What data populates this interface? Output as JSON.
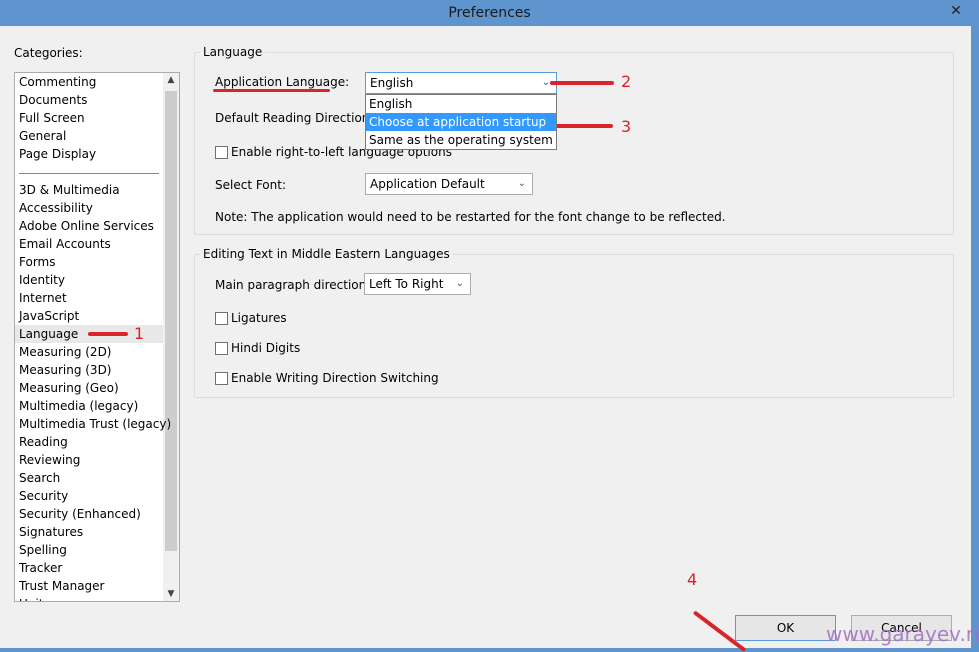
{
  "window": {
    "title": "Preferences",
    "close_icon": "close-icon"
  },
  "categories": {
    "label": "Categories:",
    "top_items": [
      "Commenting",
      "Documents",
      "Full Screen",
      "General",
      "Page Display"
    ],
    "items": [
      "3D & Multimedia",
      "Accessibility",
      "Adobe Online Services",
      "Email Accounts",
      "Forms",
      "Identity",
      "Internet",
      "JavaScript",
      "Language",
      "Measuring (2D)",
      "Measuring (3D)",
      "Measuring (Geo)",
      "Multimedia (legacy)",
      "Multimedia Trust (legacy)",
      "Reading",
      "Reviewing",
      "Search",
      "Security",
      "Security (Enhanced)",
      "Signatures",
      "Spelling",
      "Tracker",
      "Trust Manager",
      "Units"
    ],
    "selected": "Language"
  },
  "language": {
    "title": "Language",
    "app_lang_label": "Application Language:",
    "app_lang_value": "English",
    "dropdown_options": [
      "English",
      "Choose at application startup",
      "Same as the operating system"
    ],
    "highlighted_option": "Choose at application startup",
    "reading_dir_label": "Default Reading Direction:",
    "rtl_label": "Enable right-to-left language options",
    "font_label": "Select Font:",
    "font_value": "Application Default",
    "note": "Note: The application would need to be restarted for the font change to be reflected."
  },
  "middle_east": {
    "title": "Editing Text in Middle Eastern Languages",
    "para_dir_label": "Main paragraph direction:",
    "para_dir_value": "Left To Right",
    "ligatures": "Ligatures",
    "hindi": "Hindi Digits",
    "switching": "Enable Writing Direction Switching"
  },
  "buttons": {
    "ok": "OK",
    "cancel": "Cancel"
  },
  "annotations": {
    "n1": "1",
    "n2": "2",
    "n3": "3",
    "n4": "4",
    "color": "#d9242b"
  },
  "watermark": "www.garayev.ru"
}
